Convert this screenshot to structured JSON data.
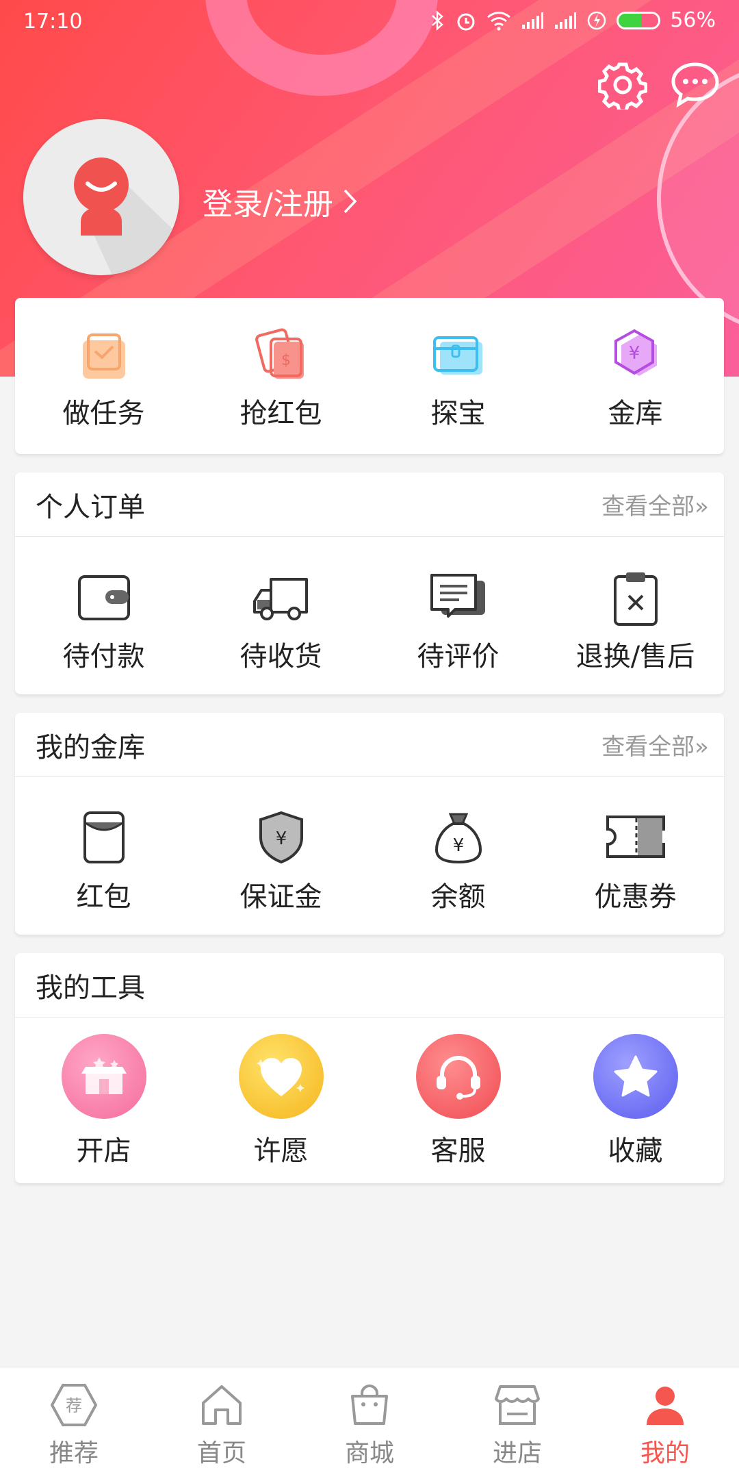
{
  "status_bar": {
    "time": "17:10",
    "battery_percent": "56%",
    "battery_level": 0.56
  },
  "profile": {
    "login_label": "登录/注册"
  },
  "quick_actions": [
    {
      "label": "做任务",
      "icon": "task-bag-icon"
    },
    {
      "label": "抢红包",
      "icon": "red-envelope-icon"
    },
    {
      "label": "探宝",
      "icon": "treasure-chest-icon"
    },
    {
      "label": "金库",
      "icon": "yuan-hexagon-icon"
    }
  ],
  "orders": {
    "title": "个人订单",
    "view_all": "查看全部»",
    "items": [
      {
        "label": "待付款",
        "icon": "wallet-icon"
      },
      {
        "label": "待收货",
        "icon": "truck-icon"
      },
      {
        "label": "待评价",
        "icon": "comment-icon"
      },
      {
        "label": "退换/售后",
        "icon": "return-clipboard-icon"
      }
    ]
  },
  "vault": {
    "title": "我的金库",
    "view_all": "查看全部»",
    "items": [
      {
        "label": "红包",
        "icon": "red-packet-icon"
      },
      {
        "label": "保证金",
        "icon": "deposit-shield-icon"
      },
      {
        "label": "余额",
        "icon": "money-bag-icon"
      },
      {
        "label": "优惠券",
        "icon": "coupon-icon"
      }
    ]
  },
  "tools": {
    "title": "我的工具",
    "items": [
      {
        "label": "开店",
        "icon": "shop-icon",
        "color": "#f67fa6"
      },
      {
        "label": "许愿",
        "icon": "heart-icon",
        "color": "#f8c52b"
      },
      {
        "label": "客服",
        "icon": "headset-icon",
        "color": "#f5545a"
      },
      {
        "label": "收藏",
        "icon": "star-icon",
        "color": "#6b6ef5"
      }
    ]
  },
  "tabbar": {
    "active_color": "#f5564e",
    "items": [
      {
        "label": "推荐",
        "icon": "recommend-hexagon-icon",
        "glyph": "荐"
      },
      {
        "label": "首页",
        "icon": "home-icon"
      },
      {
        "label": "商城",
        "icon": "shopping-bag-icon"
      },
      {
        "label": "进店",
        "icon": "storefront-icon"
      },
      {
        "label": "我的",
        "icon": "user-icon"
      }
    ]
  }
}
